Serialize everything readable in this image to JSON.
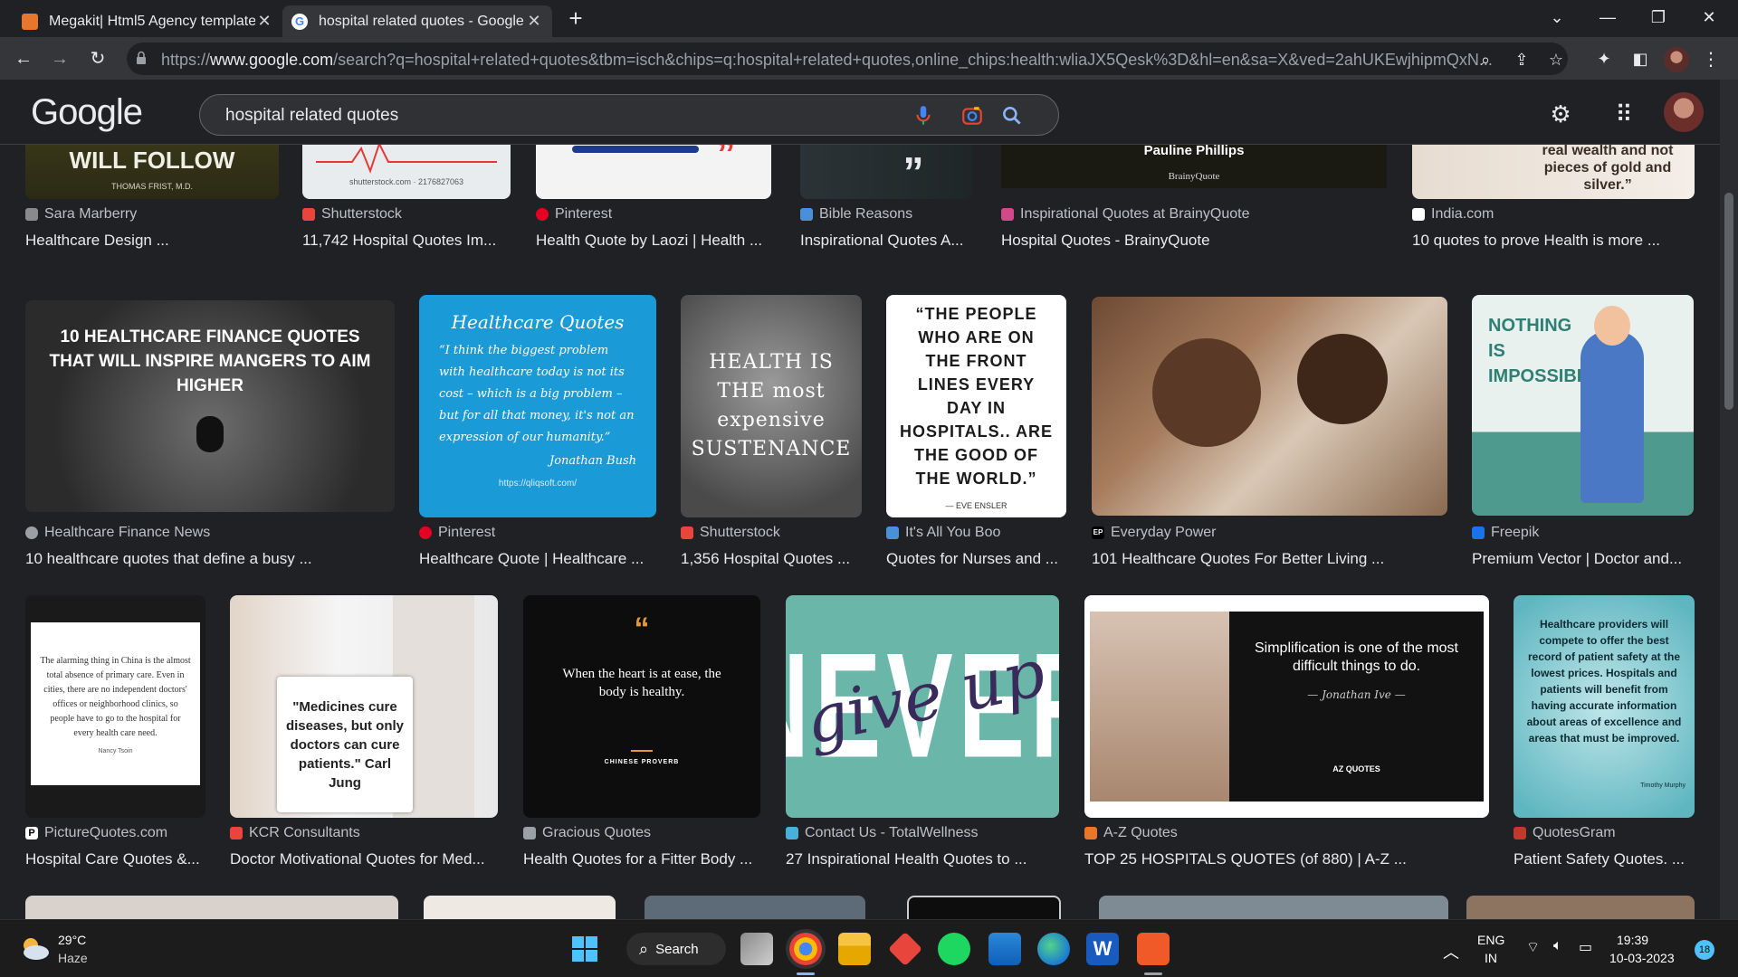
{
  "browser": {
    "tabs": [
      {
        "title": "Megakit| Html5 Agency template",
        "active": false
      },
      {
        "title": "hospital related quotes - Google",
        "active": true
      }
    ],
    "url_prefix": "https://",
    "url_host": "www.google.com",
    "url_rest": "/search?q=hospital+related+quotes&tbm=isch&chips=q:hospital+related+quotes,online_chips:health:wliaJX5Qesk%3D&hl=en&sa=X&ved=2ahUKEwjhipmQxN..."
  },
  "google": {
    "logo": "Google",
    "query": "hospital related quotes"
  },
  "rows": [
    [
      {
        "source": "Sara Marberry",
        "caption": "Healthcare Design ...",
        "thumb_text": "WILL FOLLOW",
        "thumb_sub": "THOMAS FRIST, M.D.",
        "fav": "#8a8a8a"
      },
      {
        "source": "Shutterstock",
        "caption": "11,742 Hospital Quotes Im...",
        "thumb_text": "",
        "thumb_sub": "shutterstock.com · 2176827063",
        "fav": "#e8453c"
      },
      {
        "source": "Pinterest",
        "caption": "Health Quote by Laozi | Health ...",
        "thumb_text": "",
        "thumb_sub": "",
        "fav": "#e60023"
      },
      {
        "source": "Bible Reasons",
        "caption": "Inspirational Quotes A...",
        "thumb_text": "”",
        "thumb_sub": "",
        "fav": "#4a90d9"
      },
      {
        "source": "Inspirational Quotes at BrainyQuote",
        "caption": "Hospital Quotes - BrainyQuote",
        "thumb_text": "Pauline Phillips",
        "thumb_sub": "BrainyQuote",
        "fav": "#d04a8a"
      },
      {
        "source": "India.com",
        "caption": "10 quotes to prove Health is more ...",
        "thumb_text": "real wealth and not pieces of gold and silver.”",
        "thumb_sub": "",
        "fav": "#ffffff"
      }
    ],
    [
      {
        "source": "Healthcare Finance News",
        "caption": "10 healthcare quotes that define a busy ...",
        "thumb_text": "10 HEALTHCARE FINANCE QUOTES THAT WILL INSPIRE MANGERS TO AIM HIGHER",
        "thumb_sub": "",
        "fav": "#9aa0a6"
      },
      {
        "source": "Pinterest",
        "caption": "Healthcare Quote | Healthcare ...",
        "thumb_text": "Healthcare Quotes",
        "thumb_body": "“I think the biggest problem with healthcare today is not its cost – which is a big problem – but for all that money, it's not an expression of our humanity.”",
        "thumb_sub": "Jonathan Bush",
        "thumb_url": "https://qliqsoft.com/",
        "fav": "#e60023"
      },
      {
        "source": "Shutterstock",
        "caption": "1,356 Hospital Quotes ...",
        "thumb_text": "HEALTH IS THE most expensive SUSTENANCE",
        "thumb_sub": "",
        "fav": "#e8453c"
      },
      {
        "source": "It's All You Boo",
        "caption": "Quotes for Nurses and ...",
        "thumb_text": "“THE PEOPLE WHO ARE ON THE FRONT LINES EVERY DAY IN HOSPITALS.. ARE THE GOOD OF THE WORLD.”",
        "thumb_sub": "— EVE ENSLER",
        "fav": "#4a90d9"
      },
      {
        "source": "Everyday Power",
        "caption": "101 Healthcare Quotes For Better Living ...",
        "thumb_text": "",
        "thumb_sub": "",
        "fav": "#000000"
      },
      {
        "source": "Freepik",
        "caption": "Premium Vector | Doctor and...",
        "thumb_text": "NOTHING IS IMPOSSIBLE",
        "thumb_sub": "",
        "fav": "#1a73e8"
      }
    ],
    [
      {
        "source": "PictureQuotes.com",
        "caption": "Hospital Care Quotes &...",
        "thumb_text": "The alarming thing in China is the almost total absence of primary care. Even in cities, there are no independent doctors' offices or neighborhood clinics, so people have to go to the hospital for every health care need.",
        "thumb_sub": "Nancy Tsoin",
        "fav": "#ffffff"
      },
      {
        "source": "KCR Consultants",
        "caption": "Doctor Motivational Quotes for Med...",
        "thumb_text": "\"Medicines cure diseases, but only doctors can cure patients.\" Carl Jung",
        "thumb_sub": "",
        "fav": "#e8453c"
      },
      {
        "source": "Gracious Quotes",
        "caption": "Health Quotes for a Fitter Body ...",
        "thumb_text": "When the heart is at ease, the body is healthy.",
        "thumb_sub": "CHINESE PROVERB",
        "fav": "#9aa0a6"
      },
      {
        "source": "Contact Us - TotalWellness",
        "caption": "27 Inspirational Health Quotes to ...",
        "thumb_text": "NEVER",
        "thumb_sub": "give up",
        "fav": "#4ab0d9"
      },
      {
        "source": "A-Z Quotes",
        "caption": "TOP 25 HOSPITALS QUOTES (of 880) | A-Z ...",
        "thumb_text": "Simplification is one of the most difficult things to do.",
        "thumb_sub": "— Jonathan Ive —",
        "thumb_brand": "AZ QUOTES",
        "fav": "#e8772e"
      },
      {
        "source": "QuotesGram",
        "caption": "Patient Safety Quotes. ...",
        "thumb_text": "Healthcare providers will compete to offer the best record of patient safety at the lowest prices. Hospitals and patients will benefit from having accurate information about areas of excellence and areas that must be improved.",
        "thumb_sub": "Timothy Murphy",
        "fav": "#c0392b"
      }
    ]
  ],
  "taskbar": {
    "weather_temp": "29°C",
    "weather_desc": "Haze",
    "search_label": "Search",
    "lang_top": "ENG",
    "lang_bottom": "IN",
    "time": "19:39",
    "date": "10-03-2023",
    "notif_count": "18"
  }
}
